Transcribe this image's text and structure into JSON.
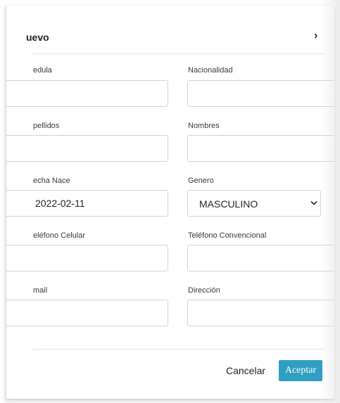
{
  "modal": {
    "title": "uevo",
    "close_glyph": "›"
  },
  "form": {
    "cedula": {
      "label": "edula",
      "value": ""
    },
    "nacionalidad": {
      "label": "Nacionalidad",
      "value": ""
    },
    "apellidos": {
      "label": "pellidos",
      "value": ""
    },
    "nombres": {
      "label": "Nombres",
      "value": ""
    },
    "fecha_nace": {
      "label": "echa Nace",
      "value": "2022-02-11"
    },
    "genero": {
      "label": "Genero",
      "selected": "MASCULINO"
    },
    "telefono_celular": {
      "label": "eléfono Celular",
      "value": ""
    },
    "telefono_convencional": {
      "label": "Teléfono Convencional",
      "value": ""
    },
    "email": {
      "label": "mail",
      "value": ""
    },
    "direccion": {
      "label": "Dirección",
      "value": ""
    }
  },
  "footer": {
    "cancel_label": "Cancelar",
    "accept_label": "Aceptar"
  },
  "colors": {
    "accent": "#2f9fc4",
    "border": "#ced4da"
  },
  "icons": {
    "close": "close-icon",
    "select_caret": "chevron-down-icon"
  }
}
